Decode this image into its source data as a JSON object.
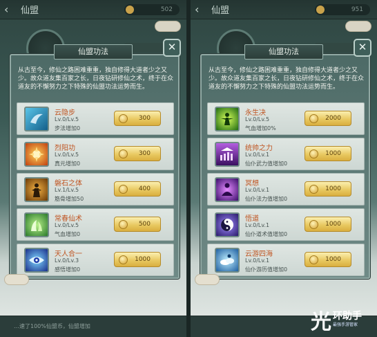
{
  "left": {
    "topbar": {
      "back": "‹",
      "title": "仙盟",
      "coins": "502"
    },
    "panel": {
      "title": "仙盟功法",
      "close": "✕",
      "description": "从古至今，修仙之路困难重重，独自修得大道者少之又少。故众道友集百家之长，日夜钻研修仙之术，终于在众道友的不懈努力之下特殊的仙盟功法运势而生。",
      "skills": [
        {
          "name": "云隐步",
          "level": "Lv.0/Lv.5",
          "effect": "步法增加0",
          "cost": "300",
          "icon": "wind-step-icon",
          "color": "#1b7fb0"
        },
        {
          "name": "烈阳功",
          "level": "Lv.0/Lv.5",
          "effect": "真元增加0",
          "cost": "300",
          "icon": "sun-fire-icon",
          "color": "#d8641c"
        },
        {
          "name": "磐石之体",
          "level": "Lv.1/Lv.5",
          "effect": "筋骨增加50",
          "cost": "400",
          "icon": "stone-body-icon",
          "color": "#b06a12"
        },
        {
          "name": "常春仙术",
          "level": "Lv.0/Lv.5",
          "effect": "气血增加0",
          "cost": "500",
          "icon": "spring-magic-icon",
          "color": "#3fa34a"
        },
        {
          "name": "天人合一",
          "level": "Lv.0/Lv.3",
          "effect": "感悟增加0",
          "cost": "1000",
          "icon": "heaven-eye-icon",
          "color": "#2b4fb8"
        }
      ]
    },
    "bottom": "…速了100%仙盟币，仙盟增加"
  },
  "right": {
    "topbar": {
      "back": "‹",
      "title": "仙盟",
      "coins": "951"
    },
    "panel": {
      "title": "仙盟功法",
      "close": "✕",
      "description": "从古至今，修仙之路困难重重，独自修得大道者少之又少。故众道友集百家之长，日夜钻研修仙之术，终于在众道友的不懈努力之下特殊的仙盟功法运势而生。",
      "skills": [
        {
          "name": "永生决",
          "level": "Lv.0/Lv.5",
          "effect": "气血增加0%",
          "cost": "2000",
          "icon": "eternal-life-icon",
          "color": "#3f9a2a"
        },
        {
          "name": "统帅之力",
          "level": "Lv.0/Lv.1",
          "effect": "仙仆武力值增加0",
          "cost": "1000",
          "icon": "commander-icon",
          "color": "#6a2ca0"
        },
        {
          "name": "冥想",
          "level": "Lv.0/Lv.1",
          "effect": "仙仆法力值增加0",
          "cost": "1000",
          "icon": "meditation-icon",
          "color": "#7a3aa8"
        },
        {
          "name": "悟道",
          "level": "Lv.0/Lv.1",
          "effect": "仙仆道术值增加0",
          "cost": "1000",
          "icon": "yin-yang-icon",
          "color": "#4b3a9a"
        },
        {
          "name": "云游四海",
          "level": "Lv.0/Lv.1",
          "effect": "仙仆游历值增加0",
          "cost": "1000",
          "icon": "travel-cloud-icon",
          "color": "#2a7ab8"
        }
      ]
    }
  },
  "watermark": {
    "mark": "光",
    "title": "环助手",
    "sub": "最强手游管家"
  }
}
